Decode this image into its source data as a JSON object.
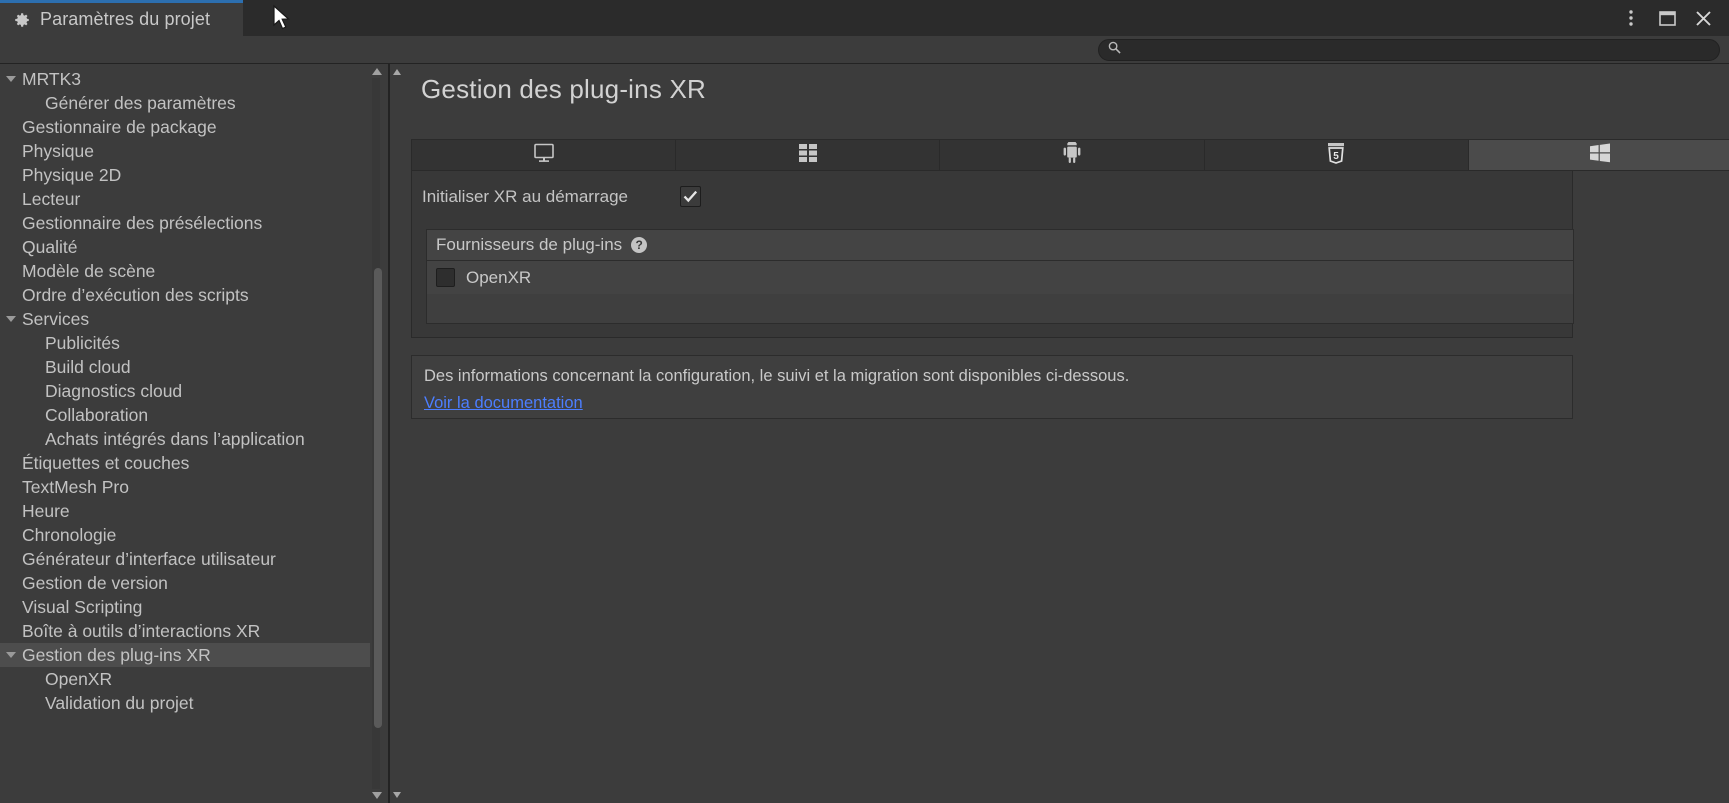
{
  "window": {
    "tab_title": "Paramètres du projet",
    "tab_icon": "gear-icon",
    "controls": [
      {
        "name": "more-options-icon",
        "glyph": "⋮"
      },
      {
        "name": "maximize-icon",
        "glyph": "❐"
      },
      {
        "name": "close-icon",
        "glyph": "✕"
      }
    ]
  },
  "search": {
    "value": "",
    "placeholder": "",
    "icon": "search-icon"
  },
  "sidebar": {
    "items": [
      {
        "label": "MRTK3",
        "level": 0,
        "expanded": true,
        "selected": false
      },
      {
        "label": "Générer des paramètres",
        "level": 1,
        "expanded": false,
        "selected": false
      },
      {
        "label": "Gestionnaire de package",
        "level": 0,
        "expanded": false,
        "selected": false
      },
      {
        "label": "Physique",
        "level": 0,
        "expanded": false,
        "selected": false
      },
      {
        "label": "Physique 2D",
        "level": 0,
        "expanded": false,
        "selected": false
      },
      {
        "label": "Lecteur",
        "level": 0,
        "expanded": false,
        "selected": false
      },
      {
        "label": "Gestionnaire des présélections",
        "level": 0,
        "expanded": false,
        "selected": false
      },
      {
        "label": "Qualité",
        "level": 0,
        "expanded": false,
        "selected": false
      },
      {
        "label": "Modèle de scène",
        "level": 0,
        "expanded": false,
        "selected": false
      },
      {
        "label": "Ordre d’exécution des scripts",
        "level": 0,
        "expanded": false,
        "selected": false
      },
      {
        "label": "Services",
        "level": 0,
        "expanded": true,
        "selected": false
      },
      {
        "label": "Publicités",
        "level": 1,
        "expanded": false,
        "selected": false
      },
      {
        "label": "Build cloud",
        "level": 1,
        "expanded": false,
        "selected": false
      },
      {
        "label": "Diagnostics cloud",
        "level": 1,
        "expanded": false,
        "selected": false
      },
      {
        "label": "Collaboration",
        "level": 1,
        "expanded": false,
        "selected": false
      },
      {
        "label": "Achats intégrés dans l’application",
        "level": 1,
        "expanded": false,
        "selected": false
      },
      {
        "label": "Étiquettes et couches",
        "level": 0,
        "expanded": false,
        "selected": false
      },
      {
        "label": "TextMesh Pro",
        "level": 0,
        "expanded": false,
        "selected": false
      },
      {
        "label": "Heure",
        "level": 0,
        "expanded": false,
        "selected": false
      },
      {
        "label": "Chronologie",
        "level": 0,
        "expanded": false,
        "selected": false
      },
      {
        "label": "Générateur d’interface utilisateur",
        "level": 0,
        "expanded": false,
        "selected": false
      },
      {
        "label": "Gestion de version",
        "level": 0,
        "expanded": false,
        "selected": false
      },
      {
        "label": "Visual Scripting",
        "level": 0,
        "expanded": false,
        "selected": false
      },
      {
        "label": "Boîte à outils d’interactions XR",
        "level": 0,
        "expanded": false,
        "selected": false
      },
      {
        "label": "Gestion des plug-ins XR",
        "level": 0,
        "expanded": true,
        "selected": true
      },
      {
        "label": "OpenXR",
        "level": 1,
        "expanded": false,
        "selected": false
      },
      {
        "label": "Validation du projet",
        "level": 1,
        "expanded": false,
        "selected": false
      }
    ]
  },
  "main": {
    "title": "Gestion des plug-ins XR",
    "platform_tabs": [
      {
        "icon": "desktop-monitor-icon",
        "label": "",
        "active": false
      },
      {
        "icon": "dedicated-server-icon",
        "label": "",
        "active": false
      },
      {
        "icon": "android-robot-icon",
        "label": "",
        "active": false
      },
      {
        "icon": "html5-webgl-icon",
        "label": "",
        "active": false
      },
      {
        "icon": "windows-logo-icon",
        "label": "",
        "active": true
      }
    ],
    "init_xr": {
      "label": "Initialiser XR au démarrage",
      "checked": true
    },
    "providers": {
      "header": "Fournisseurs de plug-ins",
      "help_icon": "help-question-icon",
      "rows": [
        {
          "name": "OpenXR",
          "checked": false
        }
      ]
    },
    "info": {
      "text": "Des informations concernant la configuration, le suivi et la migration sont disponibles ci-dessous.",
      "link": "Voir la documentation",
      "link_color": "#4c7eff"
    }
  }
}
